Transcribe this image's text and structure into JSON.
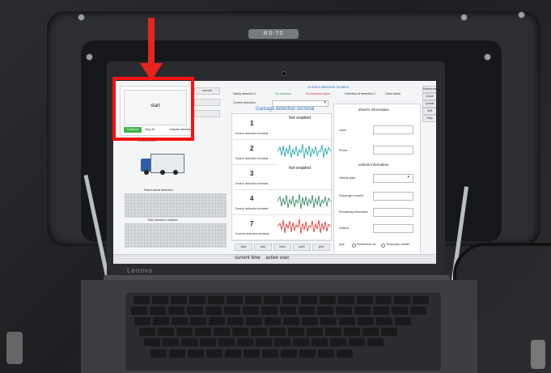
{
  "app": {
    "title": "Current detection location",
    "start_label": "start",
    "camera_label": "connect",
    "green_button": "Continue",
    "small_labels": [
      "station one",
      "Stop all",
      "Hospital admission"
    ],
    "header_fields": [
      {
        "label": "Safety detection 1",
        "value": ""
      },
      {
        "label": "No detection",
        "value": ""
      },
      {
        "label": "No detection rights",
        "value": ""
      },
      {
        "label": "Detection of detection 2",
        "value": ""
      },
      {
        "label": "Client detail",
        "value": ""
      }
    ],
    "right_menu": [
      "Reference",
      "Check",
      "Update",
      "Self Inspection",
      "Help"
    ],
    "left_mid_label": "Vehicle picture",
    "chart_label_1": "Rated actual detection",
    "chart_label_2": "Total detection variation",
    "dropdown_label": "Current detection",
    "terminal_title": "Garbage detection terminal",
    "sensors": [
      {
        "num": "1",
        "status": "Not enabled",
        "label": "Device detection terminal"
      },
      {
        "num": "2",
        "status": "",
        "label": "Device detection terminal"
      },
      {
        "num": "3",
        "status": "Not enabled",
        "label": "Device detection terminal"
      },
      {
        "num": "4",
        "status": "",
        "label": "Device detection terminal"
      },
      {
        "num": "7",
        "status": "",
        "label": "Current detection terminal"
      }
    ],
    "bottom_buttons": [
      "start",
      "stop",
      "reset",
      "open",
      "print"
    ],
    "driver_title": "driver's information",
    "driver_fields": [
      "name",
      "Phone"
    ],
    "vehicle_title": "vehicle information",
    "vehicle_fields": [
      "Vehicle plate",
      "Passenger number",
      "Remaining information",
      "Gallons"
    ],
    "radio_label": "type",
    "radio_options": [
      "Residential car",
      "Temporary vehicle"
    ],
    "status_bar": "current time    active user"
  },
  "photo": {
    "brand": "Lenovo",
    "latch_text": "RS-70"
  },
  "colors": {
    "highlight": "#ff1010",
    "arrow": "#e8241f",
    "wave_teal": "#1aa3a3",
    "wave_red": "#e02a2a",
    "wave_green": "#2e7d5a"
  }
}
